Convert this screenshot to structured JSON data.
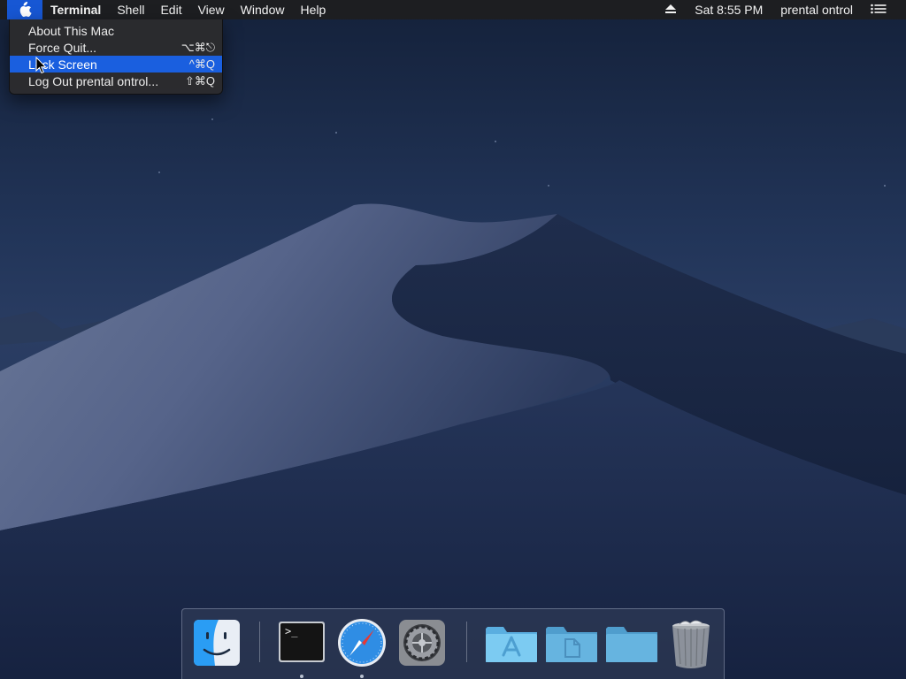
{
  "menubar": {
    "apple_icon": "apple-logo-icon",
    "app_name": "Terminal",
    "menus": [
      "Shell",
      "Edit",
      "View",
      "Window",
      "Help"
    ],
    "eject_icon": "eject-icon",
    "clock": "Sat 8:55 PM",
    "user": "prental ontrol",
    "notification_icon": "list-icon"
  },
  "apple_menu": {
    "items": [
      {
        "label": "About This Mac",
        "shortcut": ""
      },
      {
        "label": "Force Quit...",
        "shortcut": "⌥⌘⎋"
      },
      {
        "label": "Lock Screen",
        "shortcut": "^⌘Q"
      },
      {
        "label": "Log Out prental ontrol...",
        "shortcut": "⇧⌘Q"
      }
    ],
    "selected_index": 2
  },
  "dock": {
    "items": [
      {
        "name": "Finder",
        "icon": "finder-icon",
        "running": false
      },
      {
        "name": "Terminal",
        "icon": "terminal-icon",
        "running": true
      },
      {
        "name": "Safari",
        "icon": "safari-icon",
        "running": true
      },
      {
        "name": "System Preferences",
        "icon": "system-preferences-icon",
        "running": false
      },
      {
        "name": "Applications",
        "icon": "applications-folder-icon",
        "running": false
      },
      {
        "name": "Documents",
        "icon": "documents-folder-icon",
        "running": false
      },
      {
        "name": "Downloads",
        "icon": "folder-icon",
        "running": false
      },
      {
        "name": "Trash",
        "icon": "trash-icon",
        "running": false
      }
    ],
    "terminal_prompt": ">_"
  },
  "colors": {
    "menu_highlight": "#1a5fdf",
    "apple_highlight": "#1757d4",
    "folder_blue": "#6fc3ec"
  }
}
